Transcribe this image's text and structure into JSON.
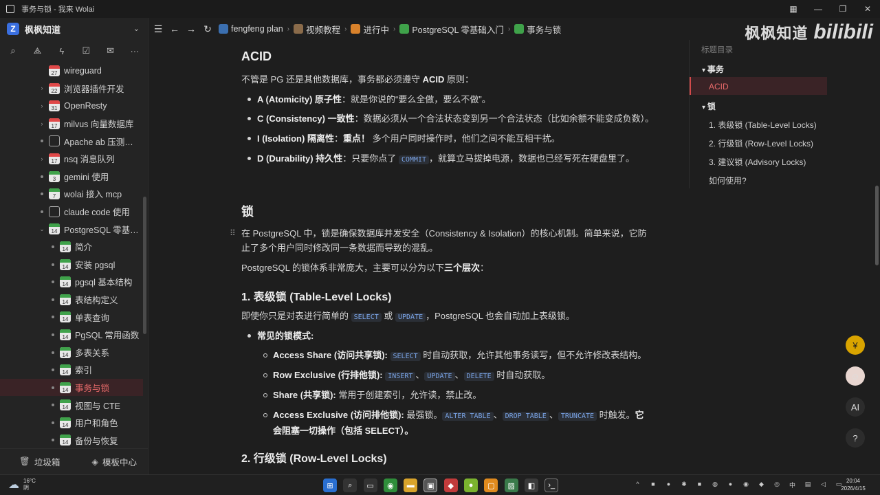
{
  "window": {
    "title": "事务与锁 - 我来 Wolai"
  },
  "sidebar": {
    "workspace": "枫枫知道",
    "tree": [
      {
        "label": "wireguard",
        "icon": "calendar-red",
        "num": "27",
        "level": 1,
        "arrow": "none"
      },
      {
        "label": "浏览器插件开发",
        "icon": "calendar-red",
        "num": "22",
        "level": 1,
        "arrow": "right"
      },
      {
        "label": "OpenResty",
        "icon": "calendar-red",
        "num": "31",
        "level": 1,
        "arrow": "right"
      },
      {
        "label": "milvus 向量数据库",
        "icon": "calendar-red",
        "num": "17",
        "level": 1,
        "arrow": "right"
      },
      {
        "label": "Apache ab 压测工具...",
        "icon": "doc",
        "num": "",
        "level": 1,
        "arrow": "dot"
      },
      {
        "label": "nsq 消息队列",
        "icon": "calendar-red",
        "num": "17",
        "level": 1,
        "arrow": "right"
      },
      {
        "label": "gemini 使用",
        "icon": "calendar-green",
        "num": "3",
        "level": 1,
        "arrow": "dot"
      },
      {
        "label": "wolai 接入 mcp",
        "icon": "calendar-green",
        "num": "7",
        "level": 1,
        "arrow": "dot"
      },
      {
        "label": "claude code 使用",
        "icon": "doc",
        "num": "",
        "level": 1,
        "arrow": "dot"
      },
      {
        "label": "PostgreSQL 零基础入...",
        "icon": "calendar-green",
        "num": "14",
        "level": 1,
        "arrow": "down"
      },
      {
        "label": "简介",
        "icon": "calendar-green",
        "num": "14",
        "level": 2,
        "arrow": "dot"
      },
      {
        "label": "安装 pgsql",
        "icon": "calendar-green",
        "num": "14",
        "level": 2,
        "arrow": "dot"
      },
      {
        "label": "pgsql 基本结构",
        "icon": "calendar-green",
        "num": "14",
        "level": 2,
        "arrow": "dot"
      },
      {
        "label": "表结构定义",
        "icon": "calendar-green",
        "num": "14",
        "level": 2,
        "arrow": "dot"
      },
      {
        "label": "单表查询",
        "icon": "calendar-green",
        "num": "14",
        "level": 2,
        "arrow": "dot"
      },
      {
        "label": "PgSQL 常用函数",
        "icon": "calendar-green",
        "num": "14",
        "level": 2,
        "arrow": "dot"
      },
      {
        "label": "多表关系",
        "icon": "calendar-green",
        "num": "14",
        "level": 2,
        "arrow": "dot"
      },
      {
        "label": "索引",
        "icon": "calendar-green",
        "num": "14",
        "level": 2,
        "arrow": "dot"
      },
      {
        "label": "事务与锁",
        "icon": "calendar-green",
        "num": "14",
        "level": 2,
        "arrow": "dot",
        "active": true
      },
      {
        "label": "视图与 CTE",
        "icon": "calendar-green",
        "num": "14",
        "level": 2,
        "arrow": "dot"
      },
      {
        "label": "用户和角色",
        "icon": "calendar-green",
        "num": "14",
        "level": 2,
        "arrow": "dot"
      },
      {
        "label": "备份与恢复",
        "icon": "calendar-green",
        "num": "14",
        "level": 2,
        "arrow": "dot"
      }
    ],
    "footer": {
      "trash": "垃圾箱",
      "templates": "模板中心"
    }
  },
  "breadcrumb": [
    {
      "label": "fengfeng plan",
      "color": "#3b6fb0"
    },
    {
      "label": "视频教程",
      "color": "#8a6b4a"
    },
    {
      "label": "进行中",
      "color": "#d9822b"
    },
    {
      "label": "PostgreSQL 零基础入门",
      "color": "#3fa24a"
    },
    {
      "label": "事务与锁",
      "color": "#3fa24a"
    }
  ],
  "brand": {
    "zh": "枫枫知道",
    "bili": "bilibili"
  },
  "doc": {
    "acid_title": "ACID",
    "acid_intro_prefix": "不管是 PG 还是其他数据库，事务都必须遵守 ",
    "acid_intro_bold": "ACID",
    "acid_intro_suffix": " 原则：",
    "a_bold": "A (Atomicity) 原子性",
    "a_text": "：就是你说的“要么全做，要么不做”。",
    "c_bold": "C (Consistency) 一致性",
    "c_text": "：数据必须从一个合法状态变到另一个合法状态（比如余额不能变成负数）。",
    "i_bold": "I (Isolation) 隔离性",
    "i_mid": "：",
    "i_bold2": "重点！",
    "i_text": " 多个用户同时操作时，他们之间不能互相干扰。",
    "d_bold": "D (Durability) 持久性",
    "d_text1": "：只要你点了 ",
    "d_code": "COMMIT",
    "d_text2": "，就算立马拔掉电源，数据也已经写死在硬盘里了。",
    "lock_title": "锁",
    "lock_p1_line1": "在 PostgreSQL 中，锁是确保数据库并发安全（Consistency & Isolation）的核心机制。简单来说，它防",
    "lock_p1_line2": "止了多个用户同时修改同一条数据而导致的混乱。",
    "lock_p2_prefix": "PostgreSQL 的锁体系非常庞大，主要可以分为以下",
    "lock_p2_bold": "三个层次",
    "lock_p2_suffix": "：",
    "table_lock_title": "1. 表级锁 (Table-Level Locks)",
    "table_lock_p_prefix": "即使你只是对表进行简单的 ",
    "table_lock_code1": "SELECT",
    "table_lock_p_or": " 或 ",
    "table_lock_code2": "UPDATE",
    "table_lock_p_suffix": "，PostgreSQL 也会自动加上表级锁。",
    "modes_bold": "常见的锁模式:",
    "m1_bold": "Access Share (访问共享锁):",
    "m1_code": "SELECT",
    "m1_text": " 时自动获取，允许其他事务读写，但不允许修改表结构。",
    "m2_bold": "Row Exclusive (行排他锁):",
    "m2_code1": "INSERT",
    "m2_sep": "、",
    "m2_code2": "UPDATE",
    "m2_code3": "DELETE",
    "m2_text": " 时自动获取。",
    "m3_bold": "Share (共享锁):",
    "m3_text": "  常用于创建索引，允许读，禁止改。",
    "m4_bold": "Access Exclusive (访问排他锁):",
    "m4_text": " 最强锁。",
    "m4_code1": "ALTER TABLE",
    "m4_code2": "DROP TABLE",
    "m4_code3": "TRUNCATE",
    "m4_text2": " 时触发。",
    "m4_bold2a": "它",
    "m4_bold2b": "会阻塞一切操作（包括 SELECT）。",
    "row_lock_title": "2. 行级锁 (Row-Level Locks)"
  },
  "toc": {
    "title": "标题目录",
    "items": [
      {
        "label": "事务",
        "bold": true,
        "caret": true
      },
      {
        "label": "ACID",
        "active": true
      },
      {
        "label": "锁",
        "bold": true,
        "caret": true
      },
      {
        "label": "1. 表级锁 (Table-Level Locks)"
      },
      {
        "label": "2. 行级锁 (Row-Level Locks)"
      },
      {
        "label": "3. 建议锁 (Advisory Locks)"
      },
      {
        "label": "如何使用?"
      }
    ]
  },
  "taskbar": {
    "weather_temp": "16°C",
    "weather_desc": "阴",
    "ime": "中",
    "time": "20:04",
    "date": "2026/4/15"
  },
  "colors": {
    "accent_red": "#d24a4a",
    "background": "#1e1e1e",
    "sidebar": "#242424",
    "code_text": "#7aa4e6"
  }
}
